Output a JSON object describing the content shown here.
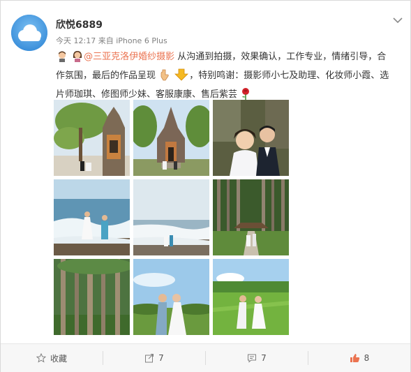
{
  "post": {
    "username": "欣悦6889",
    "timestamp": "今天 12:17",
    "source": "来自 iPhone 6 Plus",
    "mention": "@三亚克洛伊婚纱摄影",
    "text_1": "从沟通到拍摄，效果确认，工作专业，情绪引导，合作氛围，最后的作品呈现",
    "text_2": "，特别鸣谢：摄影师小七及助理、化妆师小霞、选片师珈琪、修图师少妹、客服康康、售后紫芸"
  },
  "actions": {
    "favorite_label": "收藏",
    "repost_count": "7",
    "comment_count": "7",
    "like_count": "8"
  },
  "icons": [
    "avatar-cloud",
    "chevron-down-icon",
    "man-emoji-icon",
    "woman-emoji-icon",
    "hand-pointing-down-icon",
    "down-arrow-emoji-icon",
    "rose-emoji-icon",
    "star-icon",
    "repost-icon",
    "comment-icon",
    "thumb-up-icon"
  ],
  "colors": {
    "mention": "#eb7350",
    "like": "#eb7350",
    "meta": "#808080"
  }
}
